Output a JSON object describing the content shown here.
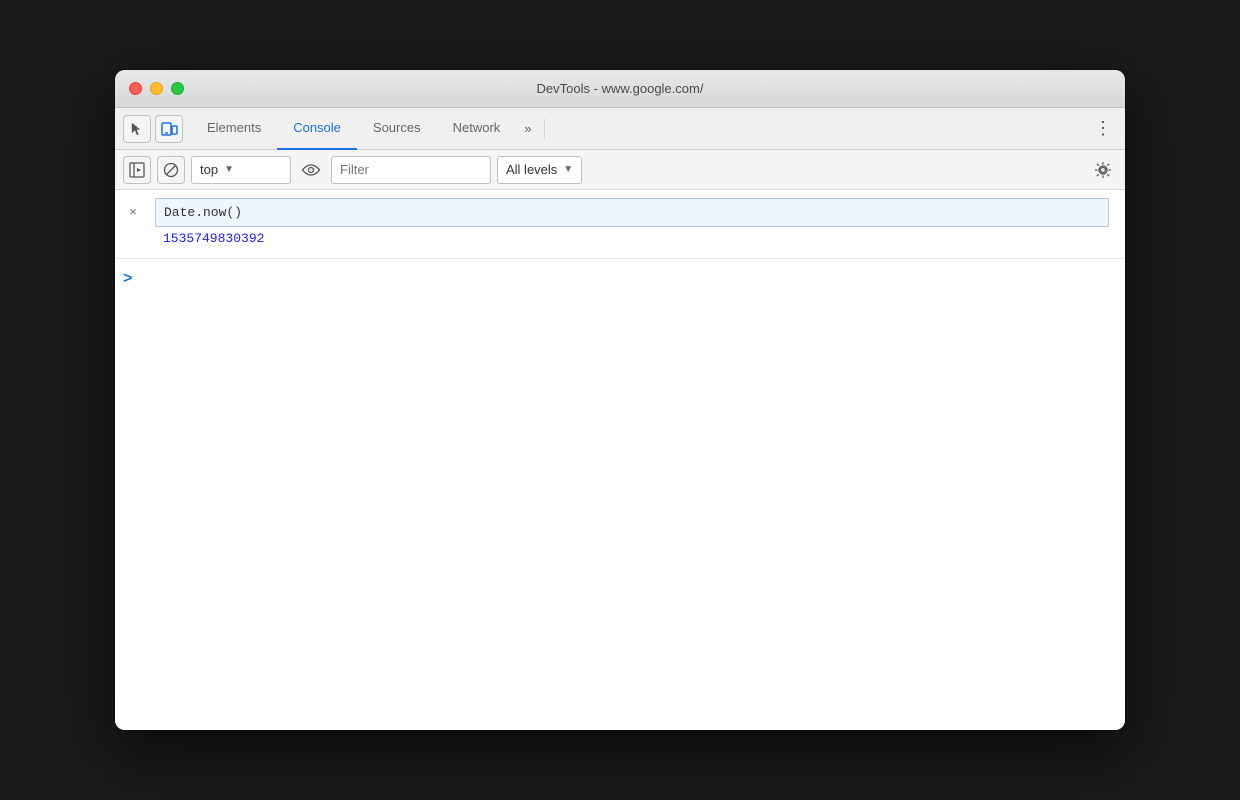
{
  "window": {
    "title": "DevTools - www.google.com/"
  },
  "traffic_lights": {
    "close_label": "close",
    "minimize_label": "minimize",
    "maximize_label": "maximize"
  },
  "tabs": {
    "items": [
      {
        "id": "elements",
        "label": "Elements",
        "active": false
      },
      {
        "id": "console",
        "label": "Console",
        "active": true
      },
      {
        "id": "sources",
        "label": "Sources",
        "active": false
      },
      {
        "id": "network",
        "label": "Network",
        "active": false
      }
    ],
    "more_label": "»",
    "menu_label": "⋮"
  },
  "toolbar": {
    "context_value": "top",
    "context_arrow": "▼",
    "filter_placeholder": "Filter",
    "levels_label": "All levels",
    "levels_arrow": "▼"
  },
  "console": {
    "entry_close": "×",
    "entry_input": "Date.now()",
    "entry_output": "1535749830392",
    "prompt_chevron": ">"
  },
  "icons": {
    "inspect": "cursor-icon",
    "device": "device-icon",
    "run": "run-icon",
    "ban": "ban-icon",
    "eye": "eye-icon",
    "gear": "gear-icon"
  }
}
